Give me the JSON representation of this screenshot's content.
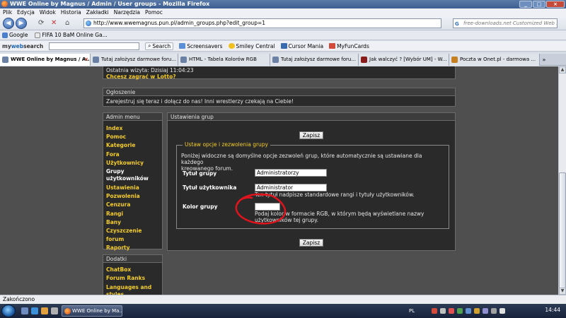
{
  "window": {
    "title": "WWE Online by Magnus / Admin / User groups - Mozilla Firefox"
  },
  "menu": [
    "Plik",
    "Edycja",
    "Widok",
    "Historia",
    "Zakładki",
    "Narzędzia",
    "Pomoc"
  ],
  "nav": {
    "url": "http://www.wwemagnus.pun.pl/admin_groups.php?edit_group=1",
    "search_placeholder": "free-downloads.net Customized Web Sea"
  },
  "bookmarks": [
    "Google",
    "FIFA 10 BaM Online Ga..."
  ],
  "toolbar2": {
    "brand_a": "my",
    "brand_b": "web",
    "brand_c": "search",
    "search_label": "Search",
    "items": [
      "Screensavers",
      "Smiley Central",
      "Cursor Mania",
      "MyFunCards"
    ]
  },
  "tabs": [
    "WWE Online by Magnus / A...",
    "Tutaj założysz darmowe foru...",
    "HTML - Tabela Kolorów RGB",
    "Tutaj założysz darmowe foru...",
    "Jak walczyć ? [Wybór UM] - W...",
    "Poczta w Onet.pl - darmowa ..."
  ],
  "page": {
    "last_visit": "Ostatnia wizyta: Dzisiaj 11:04:23",
    "lotto_link": "Chcesz zagrać w Lotto?",
    "announcement_title": "Ogłoszenie",
    "announcement_text": "Zarejestruj się teraz i dołącz do nas! Inni wrestlerzy czekają na Ciebie!",
    "admin_menu_title": "Admin menu",
    "admin_menu": [
      "Index",
      "Pomoc",
      "Kategorie",
      "Fora",
      "Użytkownicy",
      "Grupy",
      "użytkowników",
      "Ustawienia",
      "Pozwolenia",
      "Cenzura",
      "Rangi",
      "Bany",
      "Czyszczenie forum",
      "Raporty"
    ],
    "extras_title": "Dodatki",
    "extras": [
      "ChatBox",
      "Forum Ranks",
      "Languages and",
      "styles"
    ],
    "settings_title": "Ustawienia grup",
    "save_label": "Zapisz",
    "fieldset_legend": "Ustaw opcje i zezwolenia grupy",
    "intro_line1": "Poniżej widoczne są domyślne opcje zezwoleń grup, które automatycznie są ustawiane dla każdego",
    "intro_line2": "kreowanego forum.",
    "group_title_label": "Tytuł grupy",
    "group_title_value": "Administratorzy",
    "user_title_label": "Tytuł użytkownika",
    "user_title_value": "Administrator",
    "user_title_hint": "Ten tytuł nadpisze standardowe rangi i tytuły użytkowników.",
    "color_label": "Kolor grupy",
    "color_value": "",
    "color_hint_line1": "Podaj kolor w formacie RGB, w którym będą wyświetlane nazwy",
    "color_hint_line2": "użytkowników tej grupy."
  },
  "status": {
    "text": "Zakończono"
  },
  "taskbar": {
    "window": "WWE Online by Ma...",
    "lang": "PL",
    "time": "14:44"
  },
  "annotation": {
    "color": "#e0141c"
  }
}
